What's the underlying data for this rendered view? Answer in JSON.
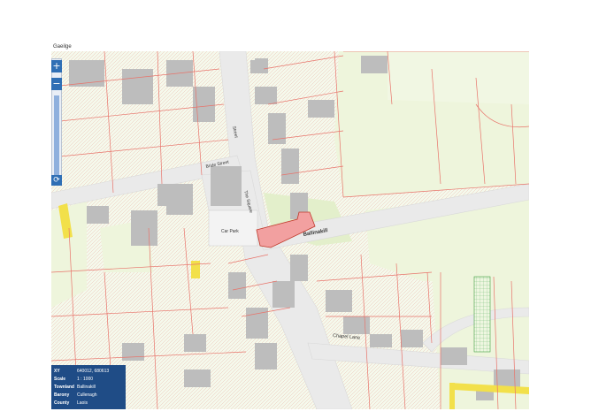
{
  "language_link": "Gaeilge",
  "zoom": {
    "in_label": "+",
    "out_label": "−",
    "reset_label": "⟳"
  },
  "labels": {
    "street_a": "Street",
    "street_b": "Bride Street",
    "street_c": "The Square",
    "car_park": "Car Park",
    "place": "Ballinakill",
    "lane": "Chapel Lane"
  },
  "info_panel": {
    "rows": [
      {
        "key": "XY",
        "value": "640012, 680613"
      },
      {
        "key": "Scale",
        "value": "1 : 1000"
      },
      {
        "key": "Townland",
        "value": "Ballinakill"
      },
      {
        "key": "Barony",
        "value": "Cullenagh"
      },
      {
        "key": "County",
        "value": "Laois"
      }
    ]
  },
  "colors": {
    "field": "#eef5dc",
    "field_hatched": "#e7f0d6",
    "road": "#ececec",
    "building": "#bfbfbf",
    "boundary": "#e8736a",
    "highlight": "#f2a0a0",
    "yellow": "#f2e04a",
    "info_bg": "#1f4c86"
  }
}
